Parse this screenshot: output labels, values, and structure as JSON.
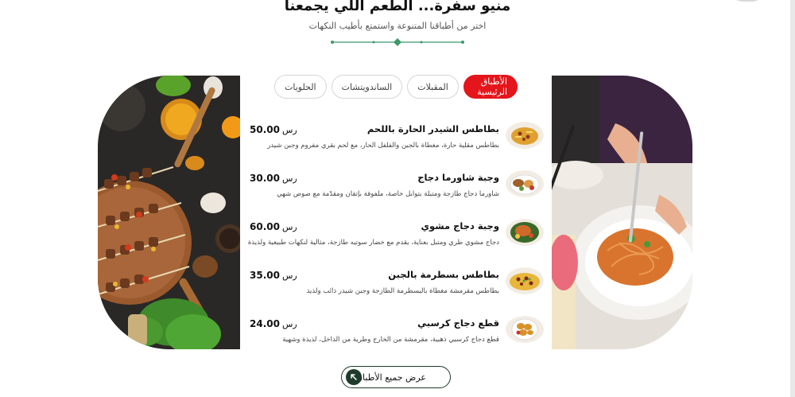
{
  "header": {
    "title": "منيو سفرة... الطعم اللي يجمعنا",
    "subtitle": "اختر من أطباقنا المتنوعة واستمتع بأطيب النكهات"
  },
  "tabs": [
    {
      "label": "الأطباق الرئيسية",
      "active": true
    },
    {
      "label": "المقبلات",
      "active": false
    },
    {
      "label": "الساندويتشات",
      "active": false
    },
    {
      "label": "الحلويات",
      "active": false
    }
  ],
  "menu": {
    "currency": "رس",
    "items": [
      {
        "name": "بطاطس الشيدر الحارة باللحم",
        "description": "بطاطس مقلية حارة، مغطاة بالجبن والفلفل الحار، مع لحم بقري مفروم وجبن شيدر",
        "price": "50.00"
      },
      {
        "name": "وجبة شاورما دجاج",
        "description": "شاورما دجاج طازجة ومتبلة بتوابل خاصة، ملفوفة بإتقان ومقدّمة مع صوص شهي",
        "price": "30.00"
      },
      {
        "name": "وجبة دجاج مشوي",
        "description": "دجاج مشوي طري ومتبل بعناية، يقدم مع خضار سوتيه طازجة، مثالية لنكهات طبيعية ولذيذة",
        "price": "60.00"
      },
      {
        "name": "بطاطس بسطرمة بالجبن",
        "description": "بطاطس مقرمشة مغطاة بالبسطرمة الطازجة وجبن شيدر ذائب ولذيذ",
        "price": "35.00"
      },
      {
        "name": "قطع دجاج كرسبي",
        "description": "قطع دجاج كرسبي ذهبية، مقرمشة من الخارج وطرية من الداخل، لذيذة وشهية",
        "price": "24.00"
      }
    ]
  },
  "cta": {
    "label": "عرض جميع الأطباق",
    "icon": "arrow-up-left-icon"
  },
  "colors": {
    "accent": "#e4151b",
    "dark_green": "#1e3b2b",
    "divider": "#3a9a6a"
  }
}
